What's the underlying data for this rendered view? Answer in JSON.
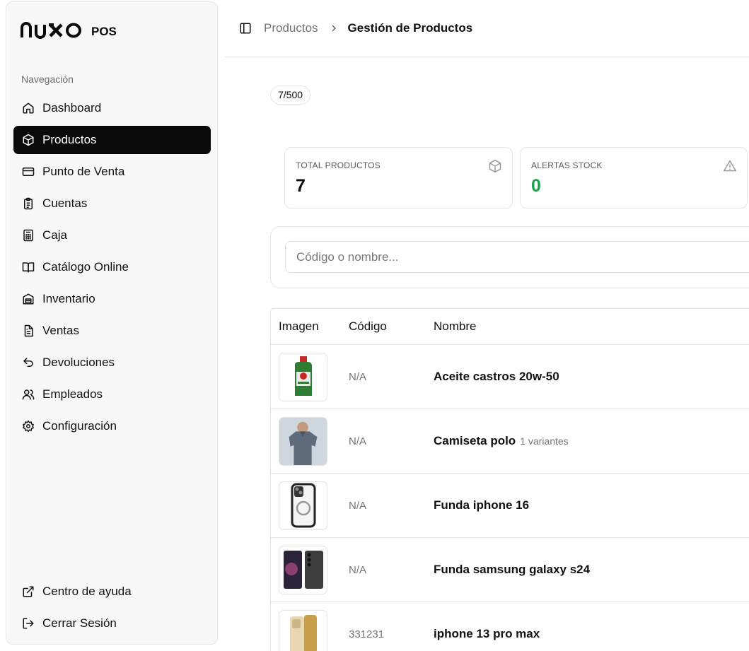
{
  "brand": {
    "logo": "NUXO",
    "suffix": "POS"
  },
  "sidebar": {
    "section_label": "Navegación",
    "items": [
      {
        "label": "Dashboard",
        "icon": "home-icon"
      },
      {
        "label": "Productos",
        "icon": "box-icon",
        "active": true
      },
      {
        "label": "Punto de Venta",
        "icon": "credit-card-icon"
      },
      {
        "label": "Cuentas",
        "icon": "clipboard-list-icon"
      },
      {
        "label": "Caja",
        "icon": "calculator-icon"
      },
      {
        "label": "Catálogo Online",
        "icon": "book-open-icon"
      },
      {
        "label": "Inventario",
        "icon": "warehouse-icon"
      },
      {
        "label": "Ventas",
        "icon": "file-text-icon"
      },
      {
        "label": "Devoluciones",
        "icon": "undo-icon"
      },
      {
        "label": "Empleados",
        "icon": "users-icon"
      },
      {
        "label": "Configuración",
        "icon": "gear-icon"
      }
    ],
    "bottom": [
      {
        "label": "Centro de ayuda",
        "icon": "external-link-icon"
      },
      {
        "label": "Cerrar Sesión",
        "icon": "log-out-icon"
      }
    ]
  },
  "breadcrumb": {
    "parent": "Productos",
    "current": "Gestión de Productos"
  },
  "counter": "7/500",
  "stats": {
    "total": {
      "label": "TOTAL PRODUCTOS",
      "value": "7"
    },
    "alerts": {
      "label": "ALERTAS STOCK",
      "value": "0",
      "color": "#16a34a"
    }
  },
  "search": {
    "placeholder": "Código o nombre...",
    "value": ""
  },
  "table": {
    "headers": {
      "image": "Imagen",
      "code": "Código",
      "name": "Nombre"
    },
    "rows": [
      {
        "code": "N/A",
        "name": "Aceite castros 20w-50",
        "variants": ""
      },
      {
        "code": "N/A",
        "name": "Camiseta polo",
        "variants": "1 variantes"
      },
      {
        "code": "N/A",
        "name": "Funda iphone 16",
        "variants": ""
      },
      {
        "code": "N/A",
        "name": "Funda samsung galaxy s24",
        "variants": ""
      },
      {
        "code": "331231",
        "name": "iphone 13 pro max",
        "variants": ""
      }
    ]
  }
}
